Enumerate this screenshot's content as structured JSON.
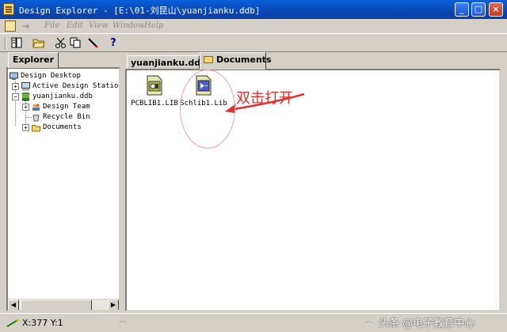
{
  "window": {
    "title": "Design Explorer - [E:\\01-刘昆山\\yuanjianku.ddb]",
    "min_glyph": "_",
    "max_glyph": "□",
    "close_glyph": "×"
  },
  "menu": {
    "items": [
      "File",
      "Edit",
      "View",
      "Window",
      "Help"
    ]
  },
  "toolbar": {
    "help_glyph": "?"
  },
  "explorer": {
    "tab_label": "Explorer",
    "tree": {
      "root": "Design Desktop",
      "active_station": "Active Design Station",
      "database": "yuanjianku.ddb",
      "children": [
        "Design Team",
        "Recycle Bin",
        "Documents"
      ]
    }
  },
  "docpanel": {
    "tabs": [
      "yuanjianku.ddb",
      "Documents"
    ],
    "files": [
      {
        "label": "PCBLIB1.LIB",
        "icon": "pcb-library-file-icon"
      },
      {
        "label": "Schlib1.Lib",
        "icon": "schematic-library-file-icon"
      }
    ],
    "annotation": "双击打开"
  },
  "statusbar": {
    "coords": "X:377 Y:1"
  },
  "watermark": "头条 @电子教育中心",
  "colors": {
    "titlebar": "#0b47b5",
    "chrome": "#d4d0c8",
    "annotation": "#e03030"
  }
}
